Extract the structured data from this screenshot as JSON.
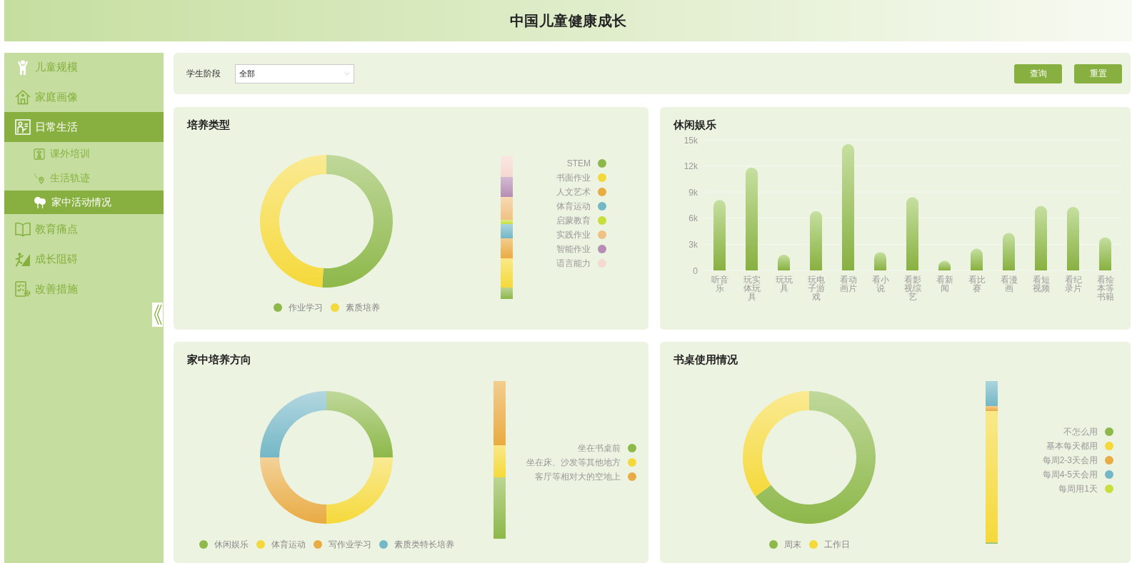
{
  "header": {
    "title": "中国儿童健康成长"
  },
  "sidebar": {
    "items": [
      {
        "label": "儿童规模",
        "selected": false
      },
      {
        "label": "家庭画像",
        "selected": false
      },
      {
        "label": "日常生活",
        "selected": true,
        "children": [
          {
            "label": "课外培训",
            "selected": false
          },
          {
            "label": "生活轨迹",
            "selected": false
          },
          {
            "label": "家中活动情况",
            "selected": true
          }
        ]
      },
      {
        "label": "教育痛点",
        "selected": false
      },
      {
        "label": "成长阻碍",
        "selected": false
      },
      {
        "label": "改善措施",
        "selected": false
      }
    ]
  },
  "filter": {
    "label": "学生阶段",
    "select": {
      "value": "全部"
    },
    "buttons": [
      "查询",
      "重置"
    ]
  },
  "cards": [
    {
      "kind": "donut",
      "title": "培养类型",
      "legend": [
        {
          "label": "作业学习",
          "color": "#8db84a"
        },
        {
          "label": "素质培养",
          "color": "#f5d93a"
        }
      ],
      "side_legend": [
        {
          "label": "STEM",
          "color": "#8db84a"
        },
        {
          "label": "书面作业",
          "color": "#f5d93a"
        },
        {
          "label": "人文艺术",
          "color": "#e9ab43"
        },
        {
          "label": "体育运动",
          "color": "#74b7c6"
        },
        {
          "label": "启蒙教育",
          "color": "#c9de3c"
        },
        {
          "label": "实践作业",
          "color": "#f0c184"
        },
        {
          "label": "智能作业",
          "color": "#b68db4"
        },
        {
          "label": "语言能力",
          "color": "#f6d9cf"
        }
      ]
    },
    {
      "kind": "bar",
      "chart_data": {
        "type": "bar",
        "title": "休闲娱乐",
        "categories": [
          "听音乐",
          "玩实体玩具",
          "玩玩具",
          "玩电子游戏",
          "看动画片",
          "看小说",
          "看影视综艺",
          "看新闻",
          "看比赛",
          "看漫画",
          "看短视频",
          "看纪录片",
          "看绘本等书籍"
        ],
        "values": [
          8100,
          11800,
          1800,
          6800,
          14500,
          2100,
          8400,
          1100,
          2500,
          4300,
          7400,
          7300,
          3800
        ],
        "ylim": [
          0,
          15000
        ],
        "yticks": [
          {
            "value": 0,
            "label": "0"
          },
          {
            "value": 3000,
            "label": "3k"
          },
          {
            "value": 6000,
            "label": "6k"
          },
          {
            "value": 9000,
            "label": "9k"
          },
          {
            "value": 12000,
            "label": "12k"
          },
          {
            "value": 15000,
            "label": "15k"
          }
        ],
        "grid": true
      }
    },
    {
      "kind": "donut",
      "title": "家中培养方向",
      "legend": [
        {
          "label": "休闲娱乐",
          "color": "#8db84a"
        },
        {
          "label": "体育运动",
          "color": "#f5d93a"
        },
        {
          "label": "写作业学习",
          "color": "#e9ab43"
        },
        {
          "label": "素质类特长培养",
          "color": "#74b7c6"
        }
      ],
      "side_legend": [
        {
          "label": "坐在书桌前",
          "color": "#8db84a"
        },
        {
          "label": "坐在床、沙发等其他地方",
          "color": "#f5d93a"
        },
        {
          "label": "客厅等相对大的空地上",
          "color": "#e9ab43"
        }
      ]
    },
    {
      "kind": "donut",
      "title": "书桌使用情况",
      "legend": [
        {
          "label": "周末",
          "color": "#8db84a"
        },
        {
          "label": "工作日",
          "color": "#f5d93a"
        }
      ],
      "side_legend": [
        {
          "label": "不怎么用",
          "color": "#8db84a"
        },
        {
          "label": "基本每天都用",
          "color": "#f5d93a"
        },
        {
          "label": "每周2-3天会用",
          "color": "#e9ab43"
        },
        {
          "label": "每周4-5天会用",
          "color": "#74b7c6"
        },
        {
          "label": "每周用1天",
          "color": "#c9de3c"
        }
      ]
    }
  ]
}
